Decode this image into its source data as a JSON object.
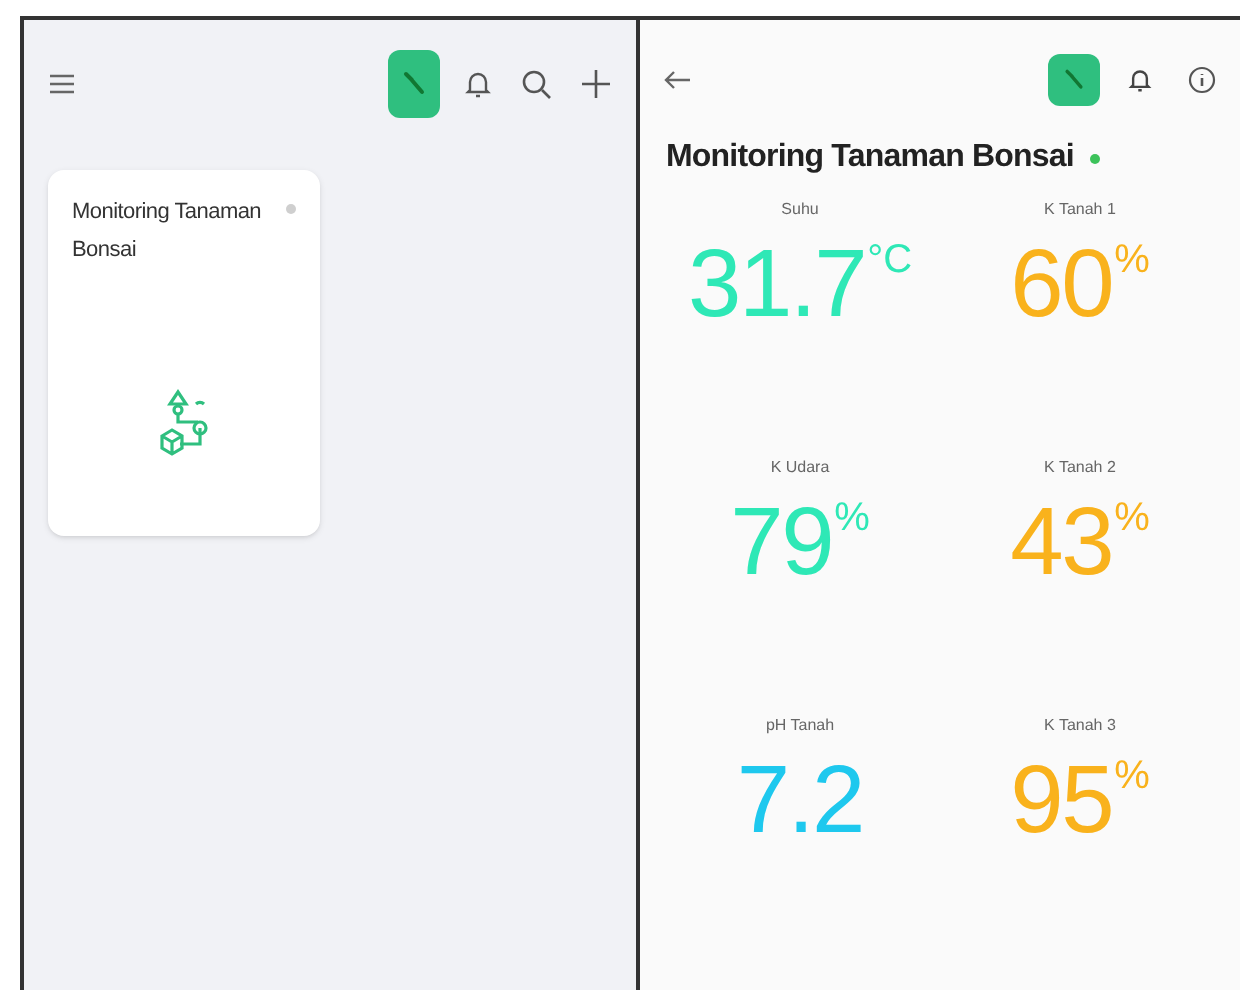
{
  "dashboard_list": {
    "cards": [
      {
        "title": "Monitoring Tanaman Bonsai",
        "online": false
      }
    ]
  },
  "device": {
    "title": "Monitoring Tanaman Bonsai",
    "online": true,
    "widgets": [
      {
        "label": "Suhu",
        "value": "31.7",
        "unit": "°C",
        "color": "#2ee8b6"
      },
      {
        "label": "K Tanah 1",
        "value": "60",
        "unit": "%",
        "color": "#f9b21c"
      },
      {
        "label": "K Udara",
        "value": "79",
        "unit": "%",
        "color": "#2ee8b6"
      },
      {
        "label": "K Tanah 2",
        "value": "43",
        "unit": "%",
        "color": "#f9b21c"
      },
      {
        "label": "pH Tanah",
        "value": "7.2",
        "color": "#1ec8ee"
      },
      {
        "label": "K Tanah 3",
        "value": "95",
        "unit": "%",
        "color": "#f9b21c"
      }
    ]
  }
}
